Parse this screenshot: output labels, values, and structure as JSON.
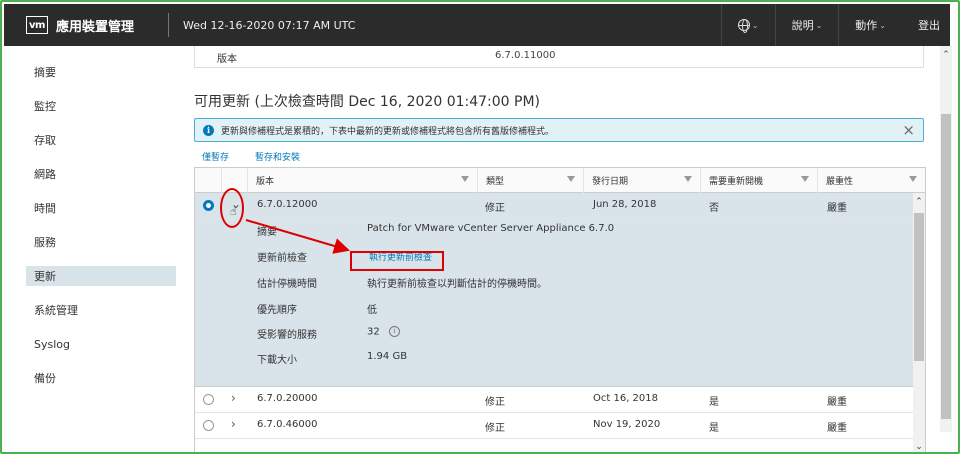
{
  "header": {
    "logo": "vm",
    "app_title": "應用裝置管理",
    "datetime": "Wed 12-16-2020 07:17 AM UTC",
    "help": "說明",
    "actions": "動作",
    "logout": "登出"
  },
  "sidebar": {
    "items": [
      {
        "label": "摘要"
      },
      {
        "label": "監控"
      },
      {
        "label": "存取"
      },
      {
        "label": "網路"
      },
      {
        "label": "時間"
      },
      {
        "label": "服務"
      },
      {
        "label": "更新"
      },
      {
        "label": "系統管理"
      },
      {
        "label": "Syslog"
      },
      {
        "label": "備份"
      }
    ],
    "active": "更新"
  },
  "current_version": {
    "label": "版本",
    "value": "6.7.0.11000"
  },
  "section_title": "可用更新 (上次檢查時間 Dec 16, 2020 01:47:00 PM)",
  "info_bar": {
    "text": "更新與修補程式是累積的，下表中最新的更新或修補程式將包含所有舊版修補程式。"
  },
  "toolbar": {
    "stage": "僅暫存",
    "stage_install": "暫存和安裝"
  },
  "grid": {
    "columns": [
      "版本",
      "類型",
      "發行日期",
      "需要重新開機",
      "嚴重性"
    ],
    "rows": [
      {
        "version": "6.7.0.12000",
        "type": "修正",
        "date": "Jun 28, 2018",
        "reboot": "否",
        "severity": "嚴重"
      },
      {
        "version": "6.7.0.20000",
        "type": "修正",
        "date": "Oct 16, 2018",
        "reboot": "是",
        "severity": "嚴重"
      },
      {
        "version": "6.7.0.46000",
        "type": "修正",
        "date": "Nov 19, 2020",
        "reboot": "是",
        "severity": "嚴重"
      }
    ],
    "detail": {
      "summary_label": "摘要",
      "summary_value": "Patch for VMware vCenter Server Appliance 6.7.0",
      "precheck_label": "更新前檢查",
      "precheck_link": "執行更新前檢查",
      "downtime_label": "估計停機時間",
      "downtime_value": "執行更新前檢查以判斷估計的停機時間。",
      "priority_label": "優先順序",
      "priority_value": "低",
      "services_label": "受影響的服務",
      "services_value": "32",
      "size_label": "下載大小",
      "size_value": "1.94 GB"
    }
  },
  "colors": {
    "header_bg": "#2b2b2b",
    "accent": "#0079b8",
    "row_selected": "#d9e4ea",
    "annotation": "#dd0000"
  }
}
